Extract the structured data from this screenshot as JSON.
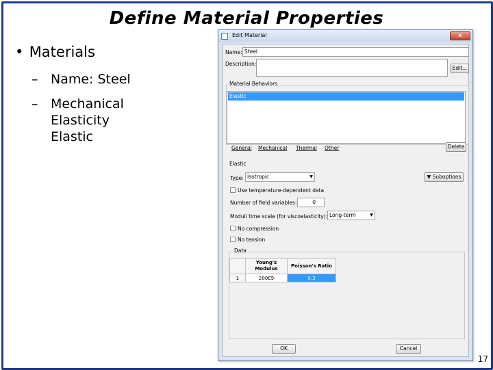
{
  "slide": {
    "title": "Define Material Properties",
    "bullet_main": "Materials",
    "bullet_name": "Name: Steel",
    "bullet_mech_1": "Mechanical",
    "bullet_mech_2": "Elasticity",
    "bullet_mech_3": "Elastic",
    "page_number": "17"
  },
  "dialog": {
    "title": "Edit Material",
    "close": "✕",
    "name_label": "Name:",
    "name_value": "Steel",
    "description_label": "Description:",
    "description_value": "",
    "edit_button": "Edit...",
    "behaviors_title": "Material Behaviors",
    "behaviors": [
      "Elastic"
    ],
    "menu": [
      "General",
      "Mechanical",
      "Thermal",
      "Other"
    ],
    "delete_button": "Delete",
    "elastic_title": "Elastic",
    "type_label": "Type:",
    "type_value": "Isotropic",
    "suboptions_button": "Suboptions",
    "temp_dependent_label": "Use temperature-dependent data",
    "field_vars_label": "Number of field variables:",
    "field_vars_value": "0",
    "moduli_label": "Moduli time scale (for viscoelasticity):",
    "moduli_value": "Long-term",
    "no_compression_label": "No compression",
    "no_tension_label": "No tension",
    "data_title": "Data",
    "table": {
      "headers": [
        "Young's Modulus",
        "Poisson's Ratio"
      ],
      "rows": [
        {
          "index": "1",
          "youngs": "200E9",
          "poisson": "0.3"
        }
      ]
    },
    "ok_button": "OK",
    "cancel_button": "Cancel"
  }
}
